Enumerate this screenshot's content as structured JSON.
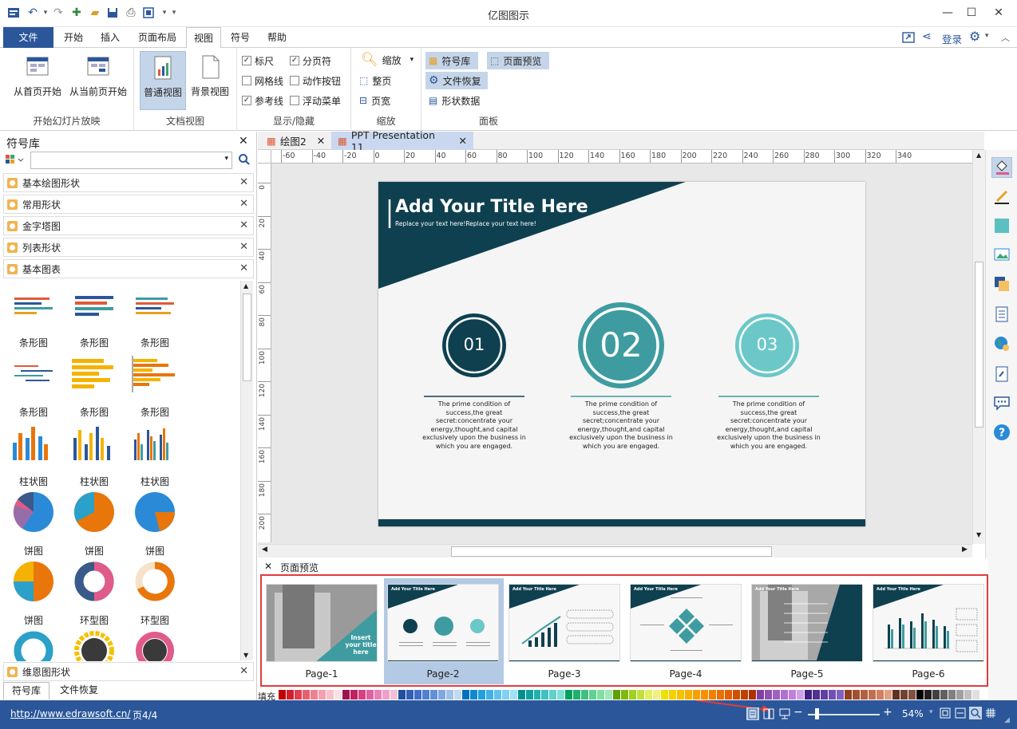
{
  "app": {
    "title": "亿图图示"
  },
  "menu": {
    "tabs": [
      {
        "label": "文件"
      },
      {
        "label": "开始"
      },
      {
        "label": "插入"
      },
      {
        "label": "页面布局"
      },
      {
        "label": "视图"
      },
      {
        "label": "符号"
      },
      {
        "label": "帮助"
      }
    ],
    "login": "登录"
  },
  "ribbon": {
    "slideshow": {
      "from_first": "从首页开始",
      "from_current": "从当前页开始",
      "group": "开始幻灯片放映"
    },
    "docview": {
      "normal": "普通视图",
      "background": "背景视图",
      "group": "文档视图"
    },
    "showhide": {
      "ruler": "标尺",
      "pagebreak": "分页符",
      "grid": "网格线",
      "action_btn": "动作按钮",
      "guide": "参考线",
      "float_menu": "浮动菜单",
      "group": "显示/隐藏"
    },
    "zoom": {
      "zoom": "缩放",
      "whole": "整页",
      "width": "页宽",
      "group": "缩放"
    },
    "panel": {
      "library": "符号库",
      "page_preview": "页面预览",
      "file_recover": "文件恢复",
      "shape_data": "形状数据",
      "group": "面板"
    }
  },
  "library": {
    "title": "符号库",
    "groups": [
      {
        "label": "基本绘图形状"
      },
      {
        "label": "常用形状"
      },
      {
        "label": "金字塔图"
      },
      {
        "label": "列表形状"
      },
      {
        "label": "基本图表"
      }
    ],
    "bottom_group": "维恩图形状",
    "shapes": [
      {
        "label": "条形图"
      },
      {
        "label": "条形图"
      },
      {
        "label": "条形图"
      },
      {
        "label": "条形图"
      },
      {
        "label": "条形图"
      },
      {
        "label": "条形图"
      },
      {
        "label": "柱状图"
      },
      {
        "label": "柱状图"
      },
      {
        "label": "柱状图"
      },
      {
        "label": "饼图"
      },
      {
        "label": "饼图"
      },
      {
        "label": "饼图"
      },
      {
        "label": "饼图"
      },
      {
        "label": "环型图"
      },
      {
        "label": "环型图"
      }
    ],
    "bottom_tabs": [
      {
        "label": "符号库"
      },
      {
        "label": "文件恢复"
      }
    ]
  },
  "doctabs": [
    {
      "label": "绘图2"
    },
    {
      "label": "PPT Presentation 11"
    }
  ],
  "ruler": {
    "h": [
      "-60",
      "-40",
      "-20",
      "0",
      "20",
      "40",
      "60",
      "80",
      "100",
      "120",
      "140",
      "160",
      "180",
      "200",
      "220",
      "240",
      "260",
      "280",
      "300",
      "320",
      "340"
    ],
    "v": [
      "0",
      "20",
      "40",
      "60",
      "80",
      "100",
      "120",
      "140",
      "160",
      "180",
      "200"
    ]
  },
  "slide": {
    "title": "Add Your Title Here",
    "subtitle": "Replace your text here!Replace your text here!",
    "circles": [
      {
        "num": "01",
        "text": "The prime condition of success,the great secret:concentrate your energy,thought,and capital exclusively upon the business in which you are engaged."
      },
      {
        "num": "02",
        "text": "The prime condition of success,the great secret;concentrate your energy,thought,and capital exclusively upon the business in which you are engaged."
      },
      {
        "num": "03",
        "text": "The prime condition of success,the great secret:concentrate your energy,thought,and capital exclusively upon the business in which you are engaged."
      }
    ]
  },
  "preview": {
    "title": "页面预览",
    "pages": [
      {
        "label": "Page-1"
      },
      {
        "label": "Page-2"
      },
      {
        "label": "Page-3"
      },
      {
        "label": "Page-4"
      },
      {
        "label": "Page-5"
      },
      {
        "label": "Page-6"
      }
    ],
    "page1_text": "Insert your title here",
    "thumb_title": "Add Your Title Here"
  },
  "fill_label": "填充",
  "status": {
    "url": "http://www.edrawsoft.cn/",
    "page": "页4/4",
    "zoom": "54%"
  },
  "colors": {
    "accent": "#2b579a",
    "dark_teal": "#0f4050",
    "teal": "#3e9ca0",
    "light_teal": "#6cc8c8",
    "preview_border": "#e03c3c"
  }
}
